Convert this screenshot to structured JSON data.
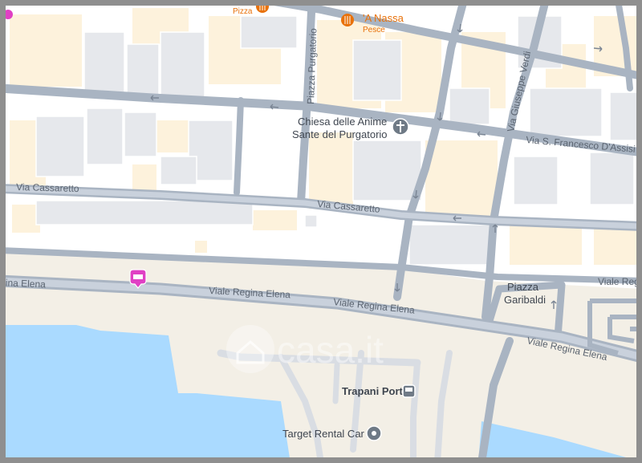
{
  "map": {
    "streets": {
      "viale_regina_elena_left": "gina Elena",
      "viale_regina_elena_1": "Viale Regina Elena",
      "viale_regina_elena_2": "Viale Regina Elena",
      "viale_regina_elena_3": "Viale Regina Elena",
      "viale_regina_elena_right": "Viale Regi",
      "via_cassaretto_1": "Via Cassaretto",
      "via_cassaretto_2": "Via Cassaretto",
      "piazza_purgatorio": "Piazza Purgatorio",
      "via_giuseppe_verdi": "Via Giuseppe Verdi",
      "via_s_francesco": "Via S. Francesco D'Assisi"
    },
    "places": {
      "piazza_garibaldi_line1": "Piazza",
      "piazza_garibaldi_line2": "Garibaldi",
      "chiesa_line1": "Chiesa delle Anime",
      "chiesa_line2": "Sante del Purgatorio",
      "trapani_port": "Trapani Port",
      "target_rental": "Target Rental Car"
    },
    "pois": {
      "nassa_name": "'A Nassa",
      "nassa_sub": "Pesce",
      "pizza_sub": "Pizza"
    },
    "watermark": "casa.it",
    "colors": {
      "water": "#aadaff",
      "land": "#f3efe6",
      "block": "#ffffff",
      "building": "#e8eaed",
      "beige": "#fdf2dc",
      "road": "#a9b4c2",
      "poi_food": "#e8710a",
      "poi_hotel": "#e040c4",
      "frame": "#8f8f8f"
    },
    "icons": [
      "restaurant-icon",
      "church-icon",
      "bus-icon",
      "pin-icon",
      "hotel-icon",
      "one-way-arrow-icon"
    ]
  }
}
